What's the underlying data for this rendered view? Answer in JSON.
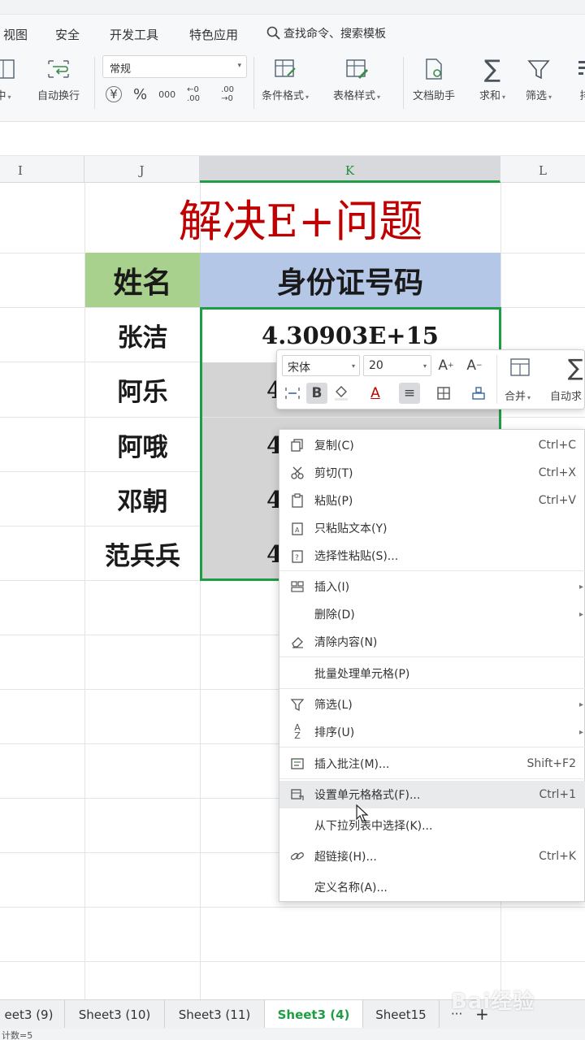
{
  "menu": {
    "tabs": [
      "视图",
      "安全",
      "开发工具",
      "特色应用"
    ],
    "search_label": "查找命令、搜索模板"
  },
  "ribbon": {
    "wrap_center_label": "中",
    "auto_wrap_label": "自动换行",
    "number_format": "常规",
    "number_buttons": [
      "¥",
      "%",
      "000",
      "←0 .00",
      ".00 →0"
    ],
    "conditional_format_label": "条件格式",
    "table_style_label": "表格样式",
    "doc_assistant_label": "文档助手",
    "sum_label": "求和",
    "filter_label": "筛选",
    "sort_label": "排"
  },
  "columns": [
    "I",
    "J",
    "K",
    "L"
  ],
  "sheet": {
    "title": "解决E+问题",
    "header_name": "姓名",
    "header_id": "身份证号码",
    "rows": [
      {
        "name": "张洁",
        "id": "4.30903E+15"
      },
      {
        "name": "阿乐",
        "id": "4"
      },
      {
        "name": "阿哦",
        "id": "4"
      },
      {
        "name": "邓朝",
        "id": "4"
      },
      {
        "name": "范兵兵",
        "id": "4"
      }
    ]
  },
  "mini_toolbar": {
    "font": "宋体",
    "size": "20",
    "merge_label": "合并",
    "autosum_label": "自动求"
  },
  "context_menu": {
    "items": [
      {
        "label": "复制(C)",
        "shortcut": "Ctrl+C",
        "icon": "copy-icon"
      },
      {
        "label": "剪切(T)",
        "shortcut": "Ctrl+X",
        "icon": "scissors-icon"
      },
      {
        "label": "粘贴(P)",
        "shortcut": "Ctrl+V",
        "icon": "paste-icon"
      },
      {
        "label": "只粘贴文本(Y)",
        "shortcut": "",
        "icon": "paste-text-icon"
      },
      {
        "label": "选择性粘贴(S)...",
        "shortcut": "",
        "icon": "paste-special-icon"
      },
      {
        "label": "插入(I)",
        "shortcut": "",
        "icon": "insert-icon"
      },
      {
        "label": "删除(D)",
        "shortcut": "",
        "icon": ""
      },
      {
        "label": "清除内容(N)",
        "shortcut": "",
        "icon": "eraser-icon"
      },
      {
        "label": "批量处理单元格(P)",
        "shortcut": "",
        "icon": ""
      },
      {
        "label": "筛选(L)",
        "shortcut": "",
        "icon": "filter-icon"
      },
      {
        "label": "排序(U)",
        "shortcut": "",
        "icon": "sort-icon"
      },
      {
        "label": "插入批注(M)...",
        "shortcut": "Shift+F2",
        "icon": "comment-icon"
      },
      {
        "label": "设置单元格格式(F)...",
        "shortcut": "Ctrl+1",
        "icon": "format-cells-icon"
      },
      {
        "label": "从下拉列表中选择(K)...",
        "shortcut": "",
        "icon": ""
      },
      {
        "label": "超链接(H)...",
        "shortcut": "Ctrl+K",
        "icon": "link-icon"
      },
      {
        "label": "定义名称(A)...",
        "shortcut": "",
        "icon": ""
      }
    ]
  },
  "sheet_tabs": [
    "eet3 (9)",
    "Sheet3 (10)",
    "Sheet3 (11)",
    "Sheet3 (4)",
    "Sheet15"
  ],
  "active_sheet": "Sheet3 (4)",
  "tab_more": "···",
  "tab_add": "+",
  "status": {
    "count": "计数=5"
  },
  "watermark": "Bai经验",
  "colors": {
    "accent": "#1f9d45",
    "title_red": "#c00000",
    "header_green": "#a9d18e",
    "header_blue": "#b4c7e7"
  }
}
